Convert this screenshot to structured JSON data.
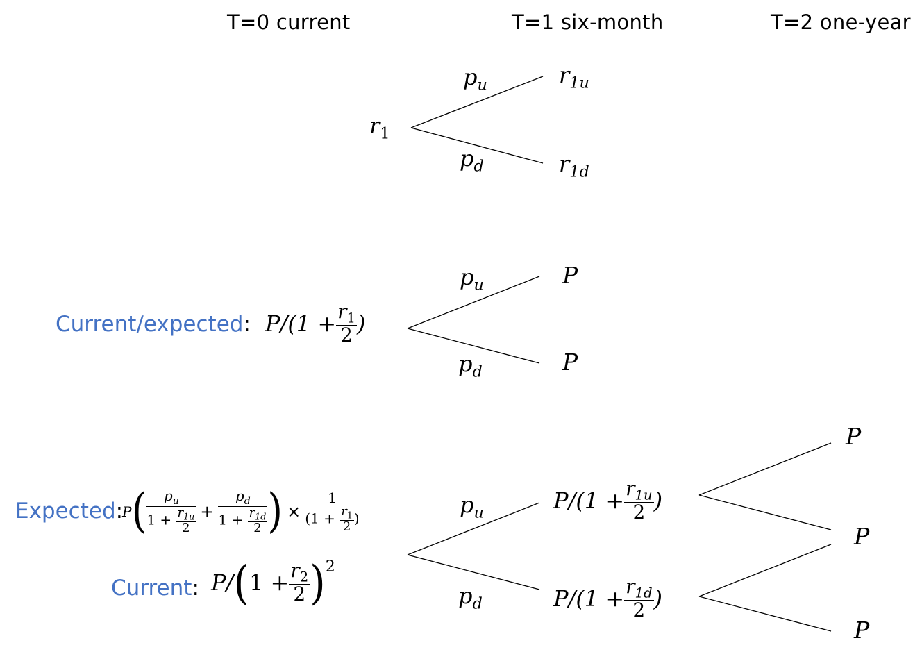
{
  "headers": {
    "t0": "T=0 current",
    "t1": "T=1 six-month",
    "t2": "T=2 one-year"
  },
  "tree1": {
    "root": {
      "base": "r",
      "sub": "1"
    },
    "up_prob": {
      "base": "p",
      "sub": "u"
    },
    "down_prob": {
      "base": "p",
      "sub": "d"
    },
    "up_node": {
      "base": "r",
      "sub": "1u"
    },
    "down_node": {
      "base": "r",
      "sub": "1d"
    }
  },
  "tree2": {
    "label": "Current/expected",
    "label_colon": ":",
    "root_prefix": "P/(1 + ",
    "root_num": {
      "base": "r",
      "sub": "1"
    },
    "root_den": "2",
    "root_suffix": ")",
    "up_prob": {
      "base": "p",
      "sub": "u"
    },
    "down_prob": {
      "base": "p",
      "sub": "d"
    },
    "up_node": "P",
    "down_node": "P"
  },
  "tree3": {
    "expected_label": "Expected",
    "expected_colon": ":",
    "expected_formula": {
      "P": "P",
      "pu": {
        "base": "p",
        "sub": "u"
      },
      "pd": {
        "base": "p",
        "sub": "d"
      },
      "one_plus": "1 + ",
      "r1u": {
        "base": "r",
        "sub": "1u"
      },
      "r1d": {
        "base": "r",
        "sub": "1d"
      },
      "two": "2",
      "plus": "+",
      "times": "×",
      "one": "1",
      "den_prefix": "(1 + ",
      "r1": {
        "base": "r",
        "sub": "1"
      },
      "den_suffix": ")"
    },
    "current_label": "Current",
    "current_colon": ":",
    "current_formula": {
      "prefix": "P/",
      "one_plus": "1 + ",
      "r2": {
        "base": "r",
        "sub": "2"
      },
      "two": "2",
      "exponent": "2"
    },
    "up_prob": {
      "base": "p",
      "sub": "u"
    },
    "down_prob": {
      "base": "p",
      "sub": "d"
    },
    "mid_up": {
      "prefix": "P/(1 + ",
      "r": {
        "base": "r",
        "sub": "1u"
      },
      "den": "2",
      "suffix": ")"
    },
    "mid_down": {
      "prefix": "P/(1 + ",
      "r": {
        "base": "r",
        "sub": "1d"
      },
      "den": "2",
      "suffix": ")"
    },
    "leaves": [
      "P",
      "P",
      "P"
    ]
  }
}
